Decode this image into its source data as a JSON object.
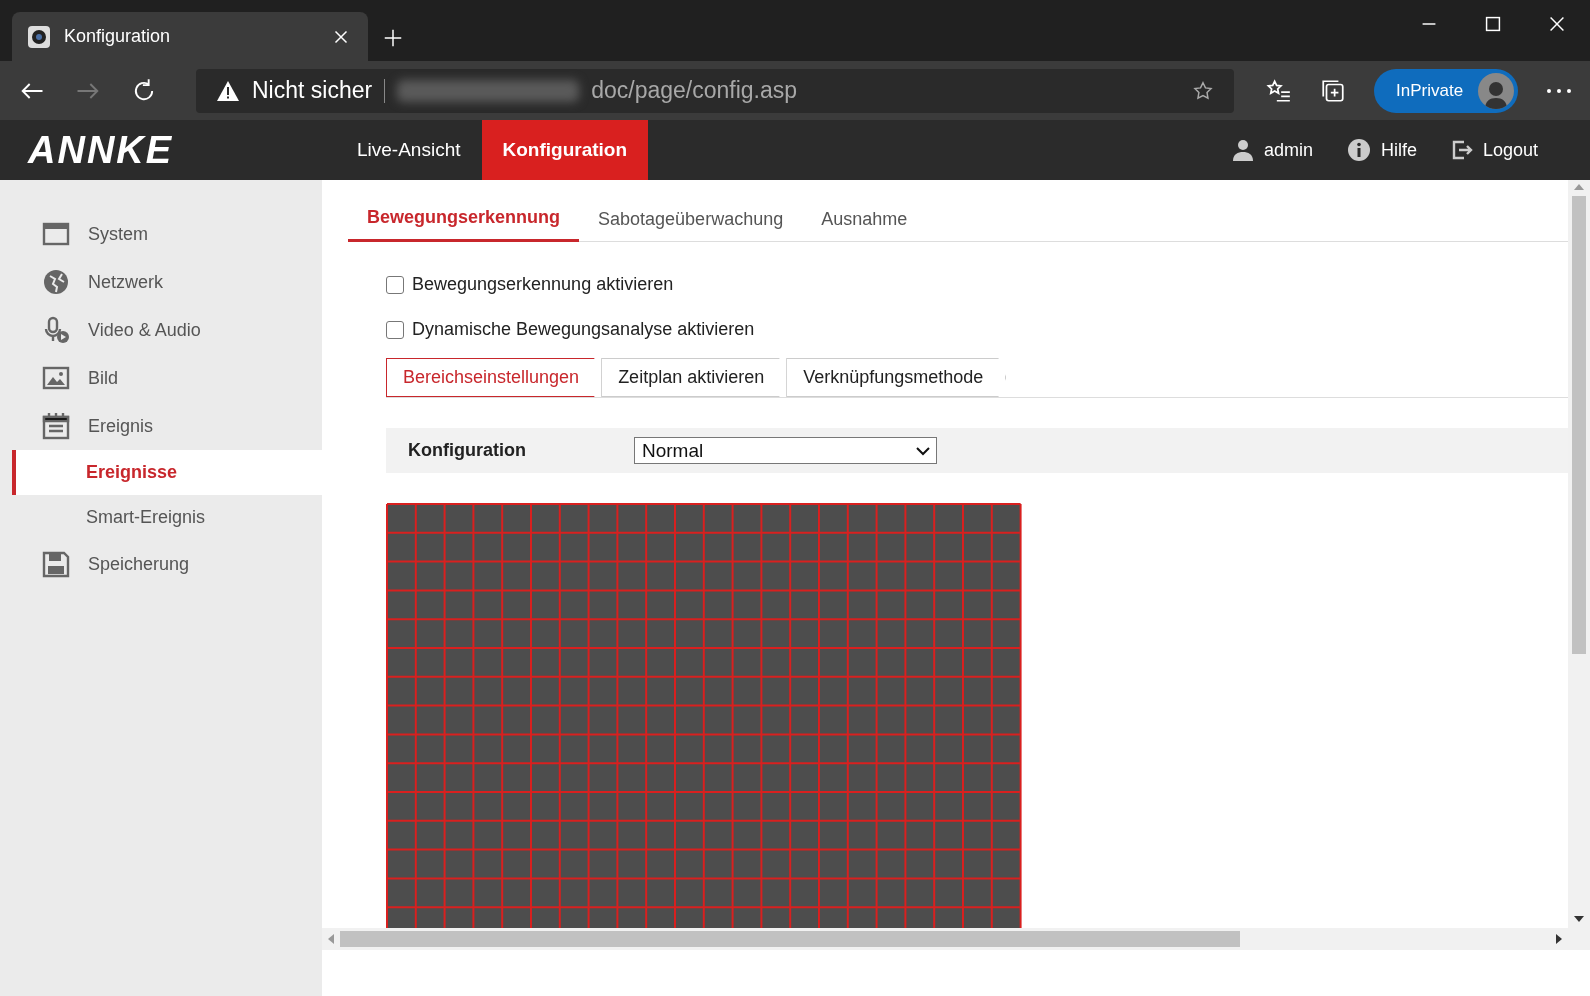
{
  "browser": {
    "tab_title": "Konfiguration",
    "security": "Nicht sicher",
    "url": "doc/page/config.asp",
    "inprivate": "InPrivate"
  },
  "header": {
    "logo": "ANNKE",
    "nav": [
      {
        "label": "Live-Ansicht",
        "selected": false
      },
      {
        "label": "Konfiguration",
        "selected": true
      }
    ],
    "links": [
      {
        "kind": "user",
        "label": "admin"
      },
      {
        "kind": "help",
        "label": "Hilfe"
      },
      {
        "kind": "logout",
        "label": "Logout"
      }
    ]
  },
  "sidebar": {
    "items": [
      {
        "kind": "system",
        "label": "System"
      },
      {
        "kind": "network",
        "label": "Netzwerk"
      },
      {
        "kind": "video",
        "label": "Video & Audio"
      },
      {
        "kind": "image",
        "label": "Bild"
      },
      {
        "kind": "event",
        "label": "Ereignis",
        "children": [
          {
            "label": "Ereignisse",
            "selected": true
          },
          {
            "label": "Smart-Ereignis",
            "selected": false
          }
        ]
      },
      {
        "kind": "storage",
        "label": "Speicherung"
      }
    ]
  },
  "tabs": [
    {
      "label": "Bewegungserkennung",
      "selected": true
    },
    {
      "label": "Sabotageüberwachung",
      "selected": false
    },
    {
      "label": "Ausnahme",
      "selected": false
    }
  ],
  "checkboxes": [
    {
      "label": "Bewegungserkennung aktivieren",
      "checked": false
    },
    {
      "label": "Dynamische Bewegungsanalyse aktivieren",
      "checked": false
    }
  ],
  "subtabs": [
    {
      "label": "Bereichseinstellungen",
      "selected": true
    },
    {
      "label": "Zeitplan aktivieren",
      "selected": false
    },
    {
      "label": "Verknüpfungsmethode",
      "selected": false
    }
  ],
  "config": {
    "label": "Konfiguration",
    "value": "Normal"
  }
}
